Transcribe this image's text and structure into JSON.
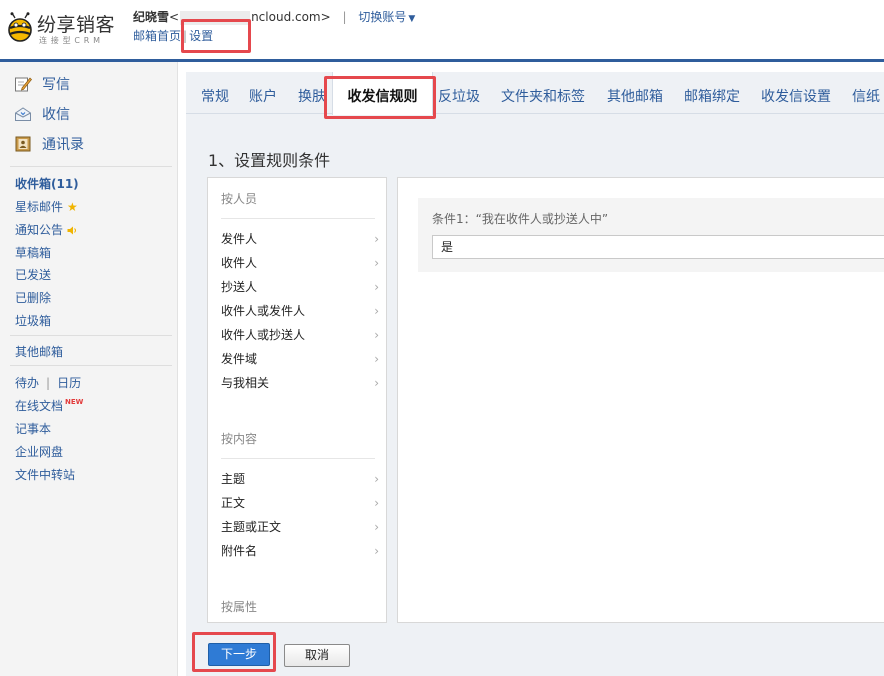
{
  "header": {
    "logo_text": "纷享销客",
    "logo_sub": "连接型CRM",
    "user_name": "纪晓雪",
    "email_prefix": "<",
    "email_domain": "ncloud.com>",
    "separator": "|",
    "switch_account": "切换账号",
    "mailbox_home": "邮箱首页",
    "link_sep": "|",
    "settings": "设置"
  },
  "sidebar": {
    "compose": "写信",
    "receive": "收信",
    "contacts": "通讯录",
    "folders": [
      {
        "label": "收件箱(11)",
        "bold": true
      },
      {
        "label": "星标邮件",
        "icon": "star-icon"
      },
      {
        "label": "通知公告",
        "icon": "speaker-icon"
      },
      {
        "label": "草稿箱"
      },
      {
        "label": "已发送"
      },
      {
        "label": "已删除"
      },
      {
        "label": "垃圾箱"
      }
    ],
    "other_mailbox": "其他邮箱",
    "todo": "待办",
    "todo_sep": "|",
    "calendar": "日历",
    "online_docs": "在线文档",
    "new_badge": "NEW",
    "notepad": "记事本",
    "netdisk": "企业网盘",
    "transfer": "文件中转站"
  },
  "tabs": [
    "常规",
    "账户",
    "换肤",
    "收发信规则",
    "反垃圾",
    "文件夹和标签",
    "其他邮箱",
    "邮箱绑定",
    "收发信设置",
    "信纸"
  ],
  "active_tab": "收发信规则",
  "step_title": "1、设置规则条件",
  "conditions": {
    "group_person": "按人员",
    "person_items": [
      "发件人",
      "收件人",
      "抄送人",
      "收件人或发件人",
      "收件人或抄送人",
      "发件域",
      "与我相关"
    ],
    "group_content": "按内容",
    "content_items": [
      "主题",
      "正文",
      "主题或正文",
      "附件名"
    ],
    "group_attr": "按属性",
    "chevron": "›"
  },
  "condition_card": {
    "label": "条件1：“我在收件人或抄送人中”",
    "value": "是"
  },
  "buttons": {
    "next": "下一步",
    "cancel": "取消"
  },
  "colors": {
    "accent": "#2f5d9c",
    "highlight": "#e5484d",
    "primary_button": "#2f7bd5"
  }
}
